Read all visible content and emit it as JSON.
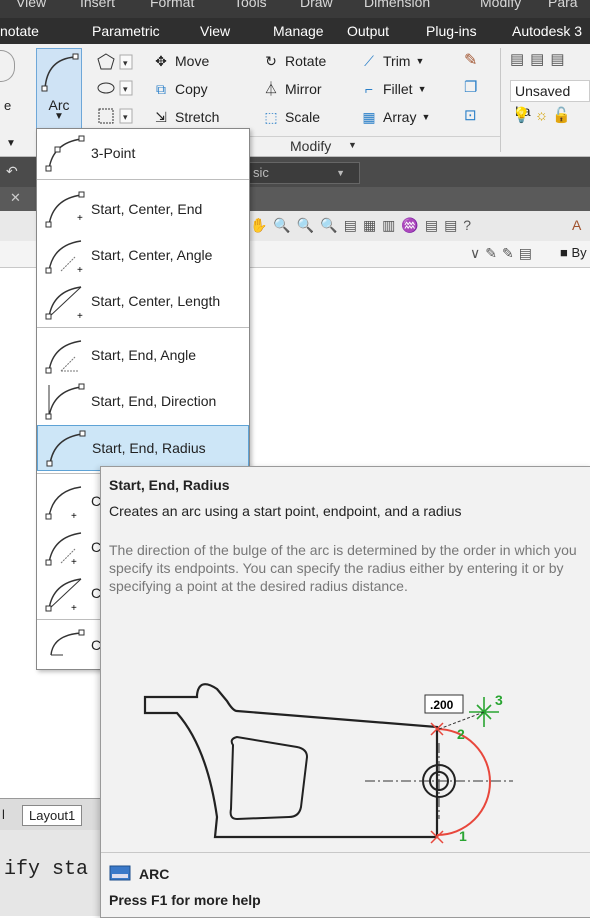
{
  "menubar": {
    "items": [
      "View",
      "Insert",
      "Format",
      "Tools",
      "Draw",
      "Dimension",
      "Modify",
      "Para"
    ]
  },
  "tabs": [
    "notate",
    "Parametric",
    "View",
    "Manage",
    "Output",
    "Plug-ins",
    "Autodesk 3"
  ],
  "ribbon": {
    "arc_label": "Arc",
    "move": "Move",
    "copy": "Copy",
    "stretch": "Stretch",
    "rotate": "Rotate",
    "mirror": "Mirror",
    "scale": "Scale",
    "trim": "Trim",
    "fillet": "Fillet",
    "array": "Array",
    "panel_label": "Modify",
    "layer_state": "Unsaved La",
    "left_frag": "e"
  },
  "toolbars": {
    "dark1_text": "sic",
    "toolbar4_right": "By"
  },
  "dropdown": {
    "items": [
      "3-Point",
      "Start, Center, End",
      "Start, Center, Angle",
      "Start, Center, Length",
      "Start, End, Angle",
      "Start, End, Direction",
      "Start, End, Radius",
      "C",
      "C",
      "C",
      "C"
    ]
  },
  "tooltip": {
    "title": "Start, End, Radius",
    "description": "Creates an arc using a start point, endpoint, and a radius",
    "detail": "The direction of the bulge of the arc is determined by the order in which you specify its endpoints. You can specify the radius either by entering it or by specifying a point at the desired radius distance.",
    "dim_value": ".200",
    "point_labels": [
      "1",
      "2",
      "3"
    ],
    "command": "ARC",
    "help": "Press F1 for more help"
  },
  "layout": {
    "tab1": "l",
    "tab2": "Layout1"
  },
  "cmdline": {
    "text": "ify sta"
  },
  "colors": {
    "selection": "#cde6f7",
    "arc_red": "#e8473c",
    "marker_green": "#2aa532"
  }
}
